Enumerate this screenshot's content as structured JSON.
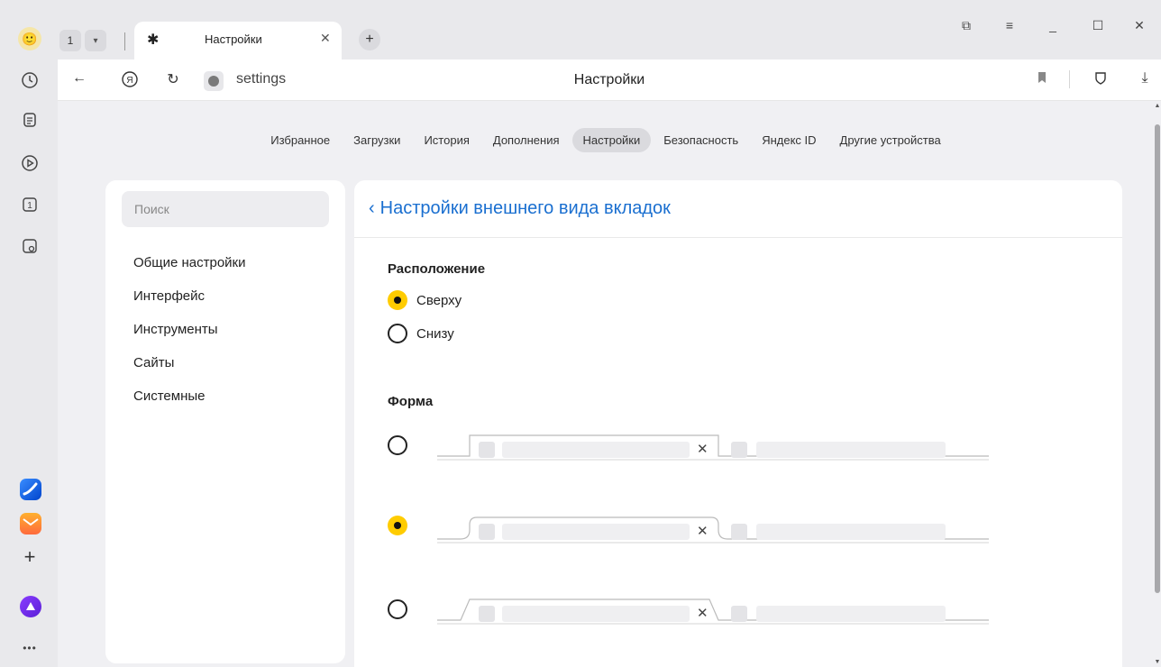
{
  "browser": {
    "tab_count": "1",
    "tab_title": "Настройки",
    "address": "settings",
    "page_title": "Настройки"
  },
  "topnav": [
    {
      "label": "Избранное",
      "active": false
    },
    {
      "label": "Загрузки",
      "active": false
    },
    {
      "label": "История",
      "active": false
    },
    {
      "label": "Дополнения",
      "active": false
    },
    {
      "label": "Настройки",
      "active": true
    },
    {
      "label": "Безопасность",
      "active": false
    },
    {
      "label": "Яндекс ID",
      "active": false
    },
    {
      "label": "Другие устройства",
      "active": false
    }
  ],
  "sidebar": {
    "search_placeholder": "Поиск",
    "items": [
      "Общие настройки",
      "Интерфейс",
      "Инструменты",
      "Сайты",
      "Системные"
    ]
  },
  "main": {
    "back_label": "Настройки внешнего вида вкладок",
    "position": {
      "title": "Расположение",
      "options": [
        {
          "label": "Сверху",
          "checked": true
        },
        {
          "label": "Снизу",
          "checked": false
        }
      ]
    },
    "shape": {
      "title": "Форма",
      "options": [
        {
          "style": "rectangular",
          "checked": false
        },
        {
          "style": "rounded",
          "checked": true
        },
        {
          "style": "trapezoid",
          "checked": false
        }
      ]
    }
  },
  "colors": {
    "accent_yellow": "#ffcc00",
    "link_blue": "#1a6fd0"
  }
}
